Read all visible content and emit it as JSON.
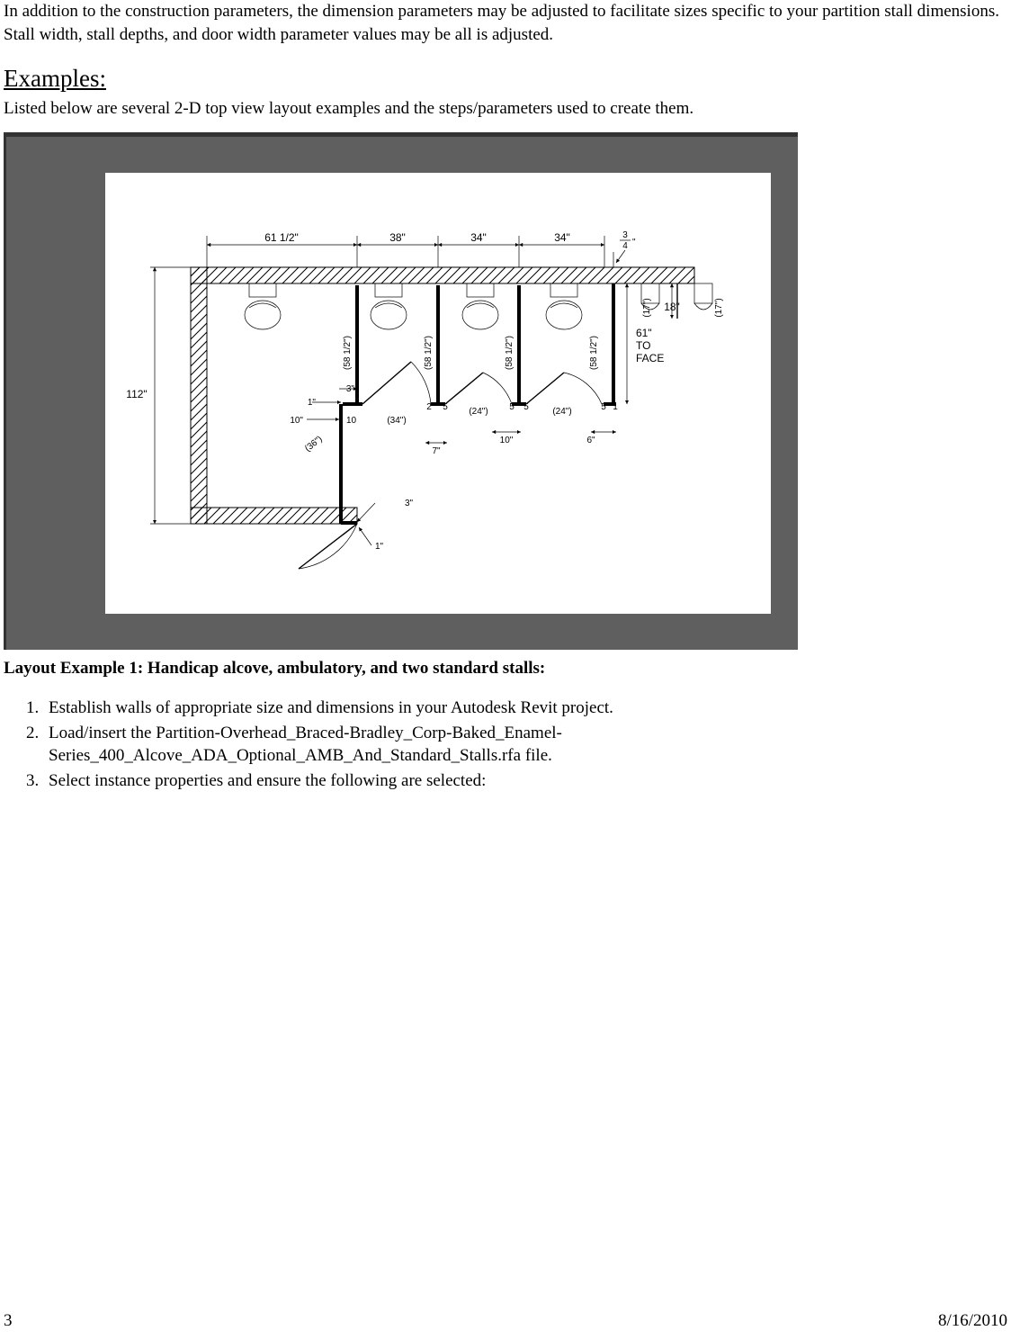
{
  "intro": {
    "para1": "In addition to the construction parameters, the dimension parameters may be adjusted to facilitate sizes specific to your partition stall dimensions. Stall width, stall depths, and door width parameter values may be all is adjusted."
  },
  "examples": {
    "heading": "Examples:",
    "lead": "Listed below are several 2-D top view layout examples and the steps/parameters used to create them."
  },
  "layout1": {
    "caption": "Layout Example 1: Handicap alcove, ambulatory, and two standard stalls:",
    "steps": [
      "Establish walls of appropriate size and dimensions in your Autodesk Revit project.",
      "Load/insert the Partition-Overhead_Braced-Bradley_Corp-Baked_Enamel-Series_400_Alcove_ADA_Optional_AMB_And_Standard_Stalls.rfa file.",
      "Select instance properties and ensure the following are selected:"
    ]
  },
  "footer": {
    "page": "3",
    "date": "8/16/2010"
  },
  "chart_data": {
    "type": "diagram",
    "title": "Top-view partition layout – handicap alcove, ambulatory, two standard stalls",
    "units": "inches",
    "overall_depth": 112,
    "top_widths": [
      "61 1/2\"",
      "38\"",
      "34\"",
      "34\""
    ],
    "wall_thickness_fraction": "3/4\"",
    "stall_depth_to_face": "61\" TO FACE",
    "stall_depths_shown": [
      "(58 1/2\")",
      "(58 1/2\")",
      "(58 1/2\")",
      "(58 1/2\")"
    ],
    "urinal_dims": {
      "depth_paren": "(17\")",
      "projection": "18\"",
      "depth_paren_2": "(17\")"
    },
    "doors": [
      {
        "label": "(36\")",
        "swing": "out-left"
      },
      {
        "label": "(34\")",
        "swing": "in"
      },
      {
        "label": "(24\")",
        "swing": "in"
      },
      {
        "label": "(24\")",
        "swing": "in"
      }
    ],
    "pilaster_and_gap_dims": {
      "left_group": [
        "3\"",
        "1\"",
        "10\"",
        "10"
      ],
      "center": [
        "2",
        "5",
        "5",
        "5",
        "5",
        "1"
      ],
      "center_spans": [
        "10\"",
        "7\"",
        "6\""
      ],
      "bottom_group": [
        "3\"",
        "1\""
      ]
    }
  }
}
